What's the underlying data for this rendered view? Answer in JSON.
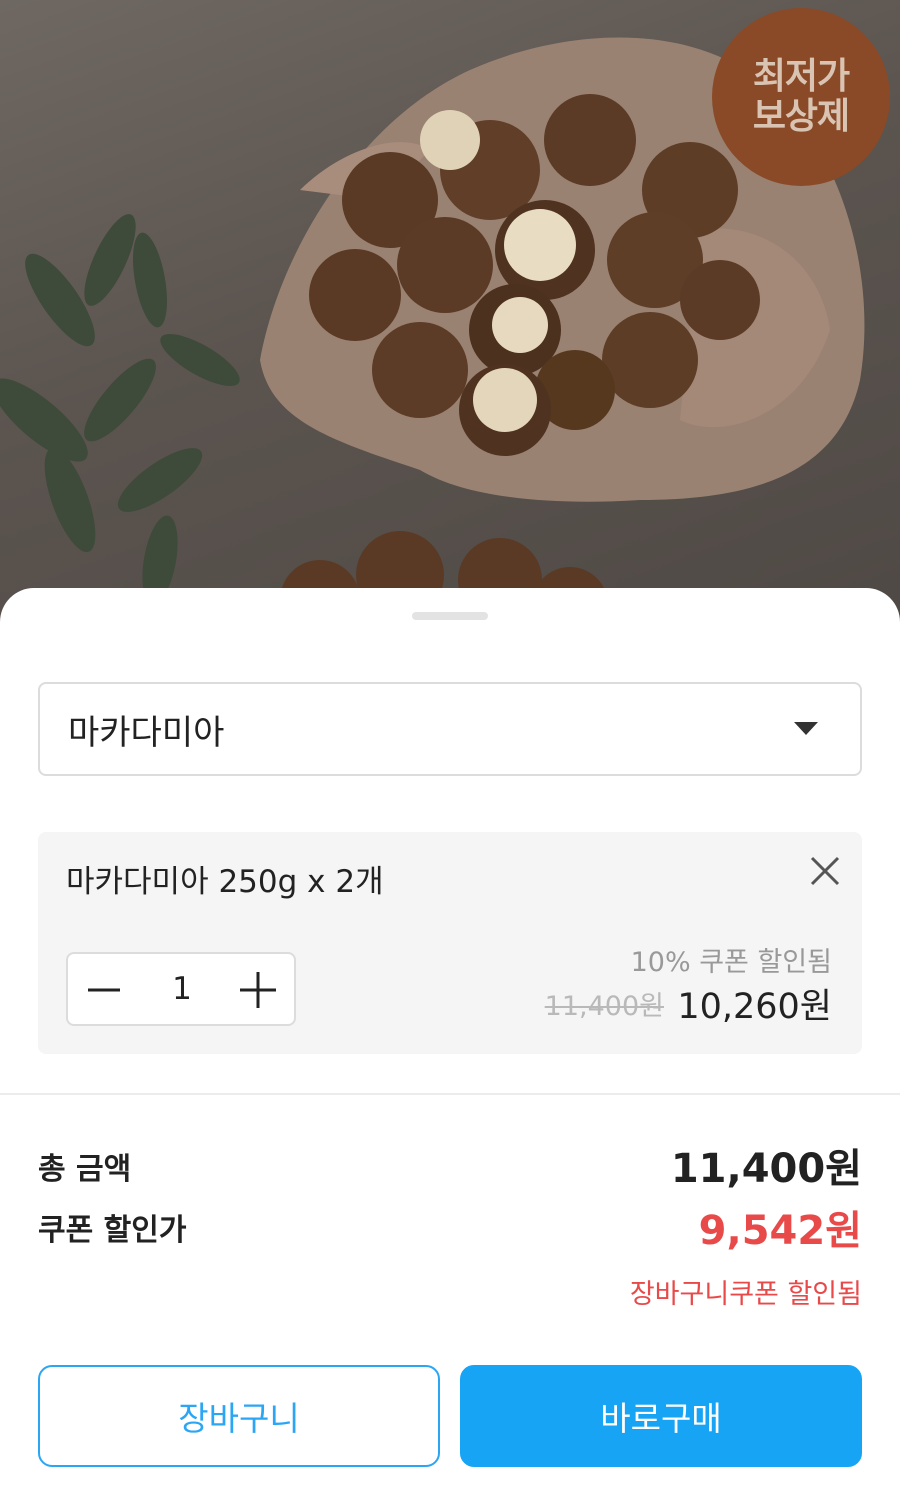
{
  "hero": {
    "badge_line1": "최저가",
    "badge_line2": "보상제",
    "icon": "product-photo-macadamia"
  },
  "option_select": {
    "selected": "마카다미아",
    "icon": "chevron-down-icon"
  },
  "selected_option": {
    "name": "마카다미아 250g x 2개",
    "quantity": "1",
    "coupon_note": "10% 쿠폰 할인됨",
    "original_price": "11,400원",
    "sale_price": "10,260원"
  },
  "summary": {
    "total_label": "총 금액",
    "total_value": "11,400원",
    "coupon_label": "쿠폰 할인가",
    "coupon_value": "9,542원",
    "cart_coupon_note": "장바구니쿠폰 할인됨"
  },
  "buttons": {
    "cart": "장바구니",
    "buy_now": "바로구매"
  },
  "colors": {
    "accent_blue": "#17a4f4",
    "discount_red": "#e84a4a",
    "badge_brown": "#8a4a28"
  }
}
